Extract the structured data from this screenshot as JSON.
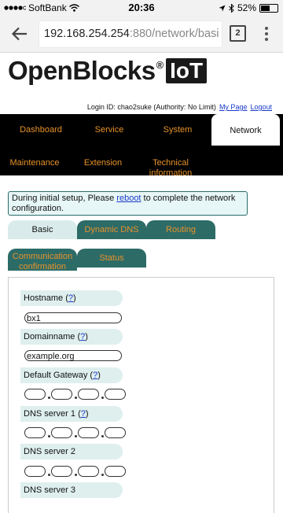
{
  "status_bar": {
    "carrier": "SoftBank",
    "time": "20:36",
    "battery": "52%"
  },
  "browser": {
    "url_host": "192.168.254.254",
    "url_path": ":880/network/basi",
    "tab_count": "2"
  },
  "header": {
    "logo_text": "OpenBlocks",
    "logo_reg": "®",
    "logo_iot": "IoT",
    "login_label": "Login ID: chao2suke (Authority: No Limit)",
    "my_page": "My Page",
    "logout": "Logout"
  },
  "nav": {
    "dashboard": "Dashboard",
    "service": "Service",
    "system": "System",
    "network": "Network",
    "maintenance": "Maintenance",
    "extension": "Extension",
    "technical_line1": "Technical",
    "technical_line2": "information"
  },
  "notice": {
    "before": "During initial setup, Please ",
    "link": "reboot",
    "after": " to complete the network configuration."
  },
  "tabs": {
    "basic": "Basic",
    "dynamic_dns": "Dynamic DNS",
    "routing": "Routing",
    "communication_line1": "Communication",
    "communication_line2": "confirmation",
    "status": "Status"
  },
  "form": {
    "hostname_label": "Hostname",
    "hostname_help": "?",
    "hostname_value": "bx1",
    "domainname_label": "Domainname",
    "domainname_help": "?",
    "domainname_value": "example.org",
    "gateway_label": "Default Gateway",
    "gateway_help": "?",
    "dns1_label": "DNS server 1",
    "dns1_help": "?",
    "dns2_label": "DNS server 2",
    "dns3_label": "DNS server 3"
  }
}
